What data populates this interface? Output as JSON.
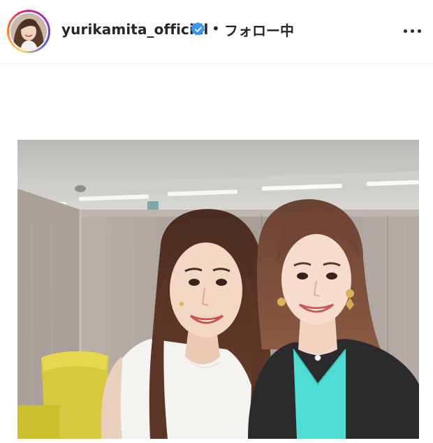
{
  "post_header": {
    "username": "yurikamita_official",
    "separator": "•",
    "follow_status": "フォロー中",
    "verified_badge_icon": "verified-badge-icon",
    "more_options_icon": "more-horizontal-icon",
    "avatar_ring_colors": [
      "#feda75",
      "#fa7e1e",
      "#d62976",
      "#962fbf",
      "#4f5bd5"
    ]
  },
  "post_media": {
    "type": "photo",
    "subject_icon": "photo-two-women-selfie"
  },
  "colors": {
    "text": "#262626",
    "verified": "#3897f0",
    "divider": "#efefef",
    "background": "#ffffff"
  }
}
